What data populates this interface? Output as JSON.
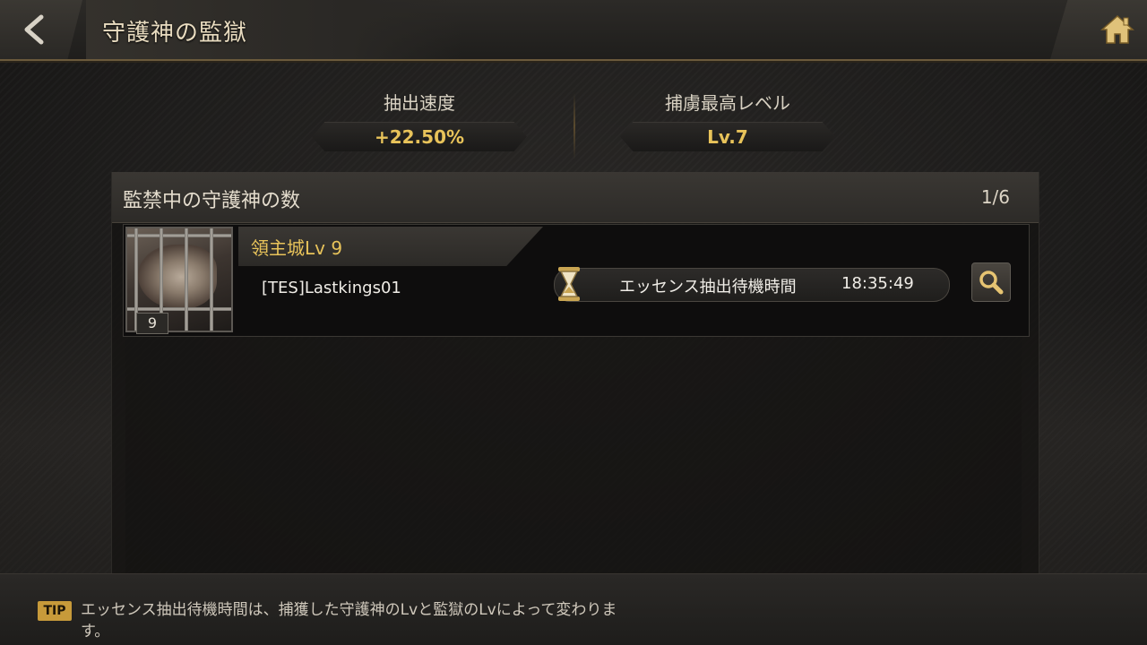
{
  "header": {
    "title": "守護神の監獄"
  },
  "stats": {
    "extract_speed_label": "抽出速度",
    "extract_speed_value": "+22.50%",
    "capture_max_label": "捕虜最高レベル",
    "capture_max_value": "Lv.7"
  },
  "panel": {
    "title": "監禁中の守護神の数",
    "count": "1/6",
    "rows": [
      {
        "level_badge": "9",
        "castle": "領主城Lv 9",
        "owner": "[TES]Lastkings01",
        "timer_label": "エッセンス抽出待機時間",
        "timer_value": "18:35:49"
      }
    ]
  },
  "footer": {
    "tip_badge": "TIP",
    "tip_text": "エッセンス抽出待機時間は、捕獲した守護神のLvと監獄のLvによって変わります。"
  },
  "colors": {
    "accent_gold": "#e8c35a",
    "tip_gold": "#c79a3a"
  },
  "icons": [
    "back-arrow-icon",
    "home-icon",
    "hourglass-icon",
    "magnifier-icon"
  ]
}
